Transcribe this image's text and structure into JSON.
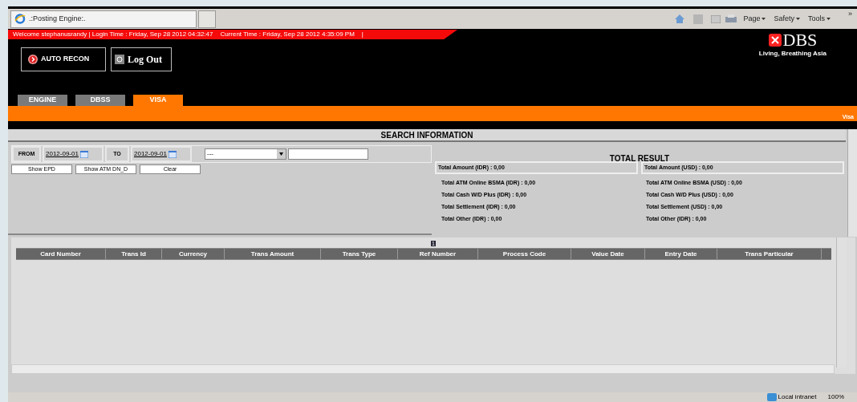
{
  "browser": {
    "tab_title": ".:Posting Engine:.",
    "toolbar": [
      "Page",
      "Safety",
      "Tools"
    ],
    "overflow": "»"
  },
  "header": {
    "welcome": "Welcome stephanusrandy | Login Time : Friday, Sep 28 2012 04:32:47    Current Time : Friday, Sep 28 2012 4:35:09 PM    |",
    "logo": "DBS",
    "tagline": "Living, Breathing Asia",
    "buttons": [
      "AUTO RECON",
      "Log Out"
    ]
  },
  "tabs": [
    {
      "label": "ENGINE",
      "selected": false
    },
    {
      "label": "DBSS",
      "selected": false
    },
    {
      "label": "VISA",
      "selected": true
    }
  ],
  "breadcrumb": "Visa",
  "search": {
    "title": "SEARCH INFORMATION",
    "from_label": "FROM",
    "from": "2012-09-01",
    "to_label": "TO",
    "to": "2012-09-01",
    "select": "---",
    "actions": [
      "Show EPD",
      "Show ATM DN_D",
      "Clear"
    ]
  },
  "totals": {
    "title": "TOTAL RESULT",
    "amount_idr": "Total Amount (IDR) : 0,00",
    "amount_usd": "Total Amount (USD) : 0,00",
    "idr": [
      "Total ATM Online BSMA (IDR) : 0,00",
      "Total Cash W/D Plus (IDR) : 0,00",
      "Total Settlement (IDR) : 0,00",
      "Total Other (IDR) : 0,00"
    ],
    "usd": [
      "Total ATM Online BSMA (USD) : 0,00",
      "Total Cash W/D Plus (USD) : 0,00",
      "Total Settlement (USD) : 0,00",
      "Total Other (IDR) : 0,00"
    ]
  },
  "table": {
    "page": "1",
    "columns": [
      "Card Number",
      "Trans Id",
      "Currency",
      "Trans Amount",
      "Trans Type",
      "Ref Number",
      "Process Code",
      "Value Date",
      "Entry Date",
      "Trans Particular"
    ]
  },
  "status_bar": {
    "zone": "Local intranet",
    "zoom": "100%"
  }
}
